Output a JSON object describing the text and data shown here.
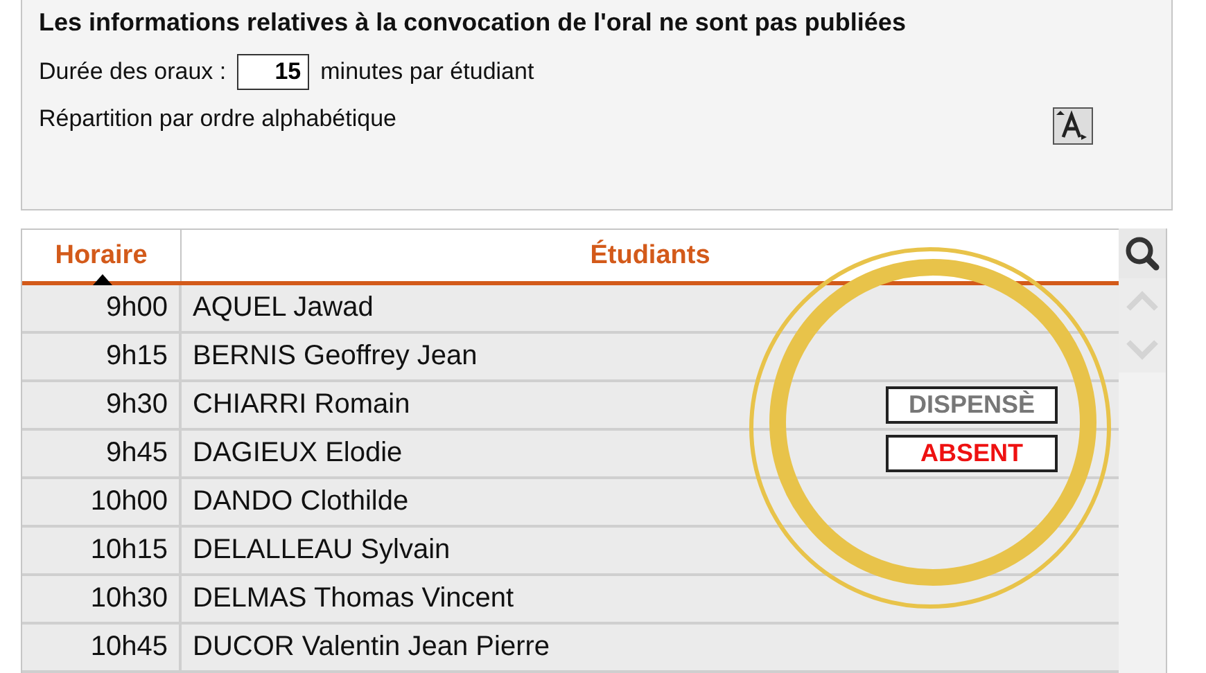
{
  "info_panel": {
    "title": "Les informations relatives à la convocation de l'oral ne sont pas publiées",
    "duration_label": "Durée des oraux :",
    "duration_value": "15",
    "duration_unit": "minutes par étudiant",
    "distribution": "Répartition par ordre alphabétique"
  },
  "table": {
    "columns": [
      {
        "label": "Horaire",
        "sorted": true
      },
      {
        "label": "Étudiants",
        "sorted": false
      }
    ],
    "rows": [
      {
        "time": "9h00",
        "student": "AQUEL Jawad"
      },
      {
        "time": "9h15",
        "student": "BERNIS Geoffrey Jean"
      },
      {
        "time": "9h30",
        "student": "CHIARRI Romain",
        "badge": {
          "kind": "dispensed",
          "label": "DISPENSÈ"
        }
      },
      {
        "time": "9h45",
        "student": "DAGIEUX Elodie",
        "badge": {
          "kind": "absent",
          "label": "ABSENT"
        }
      },
      {
        "time": "10h00",
        "student": "DANDO Clothilde"
      },
      {
        "time": "10h15",
        "student": "DELALLEAU Sylvain"
      },
      {
        "time": "10h30",
        "student": "DELMAS Thomas Vincent"
      },
      {
        "time": "10h45",
        "student": "DUCOR Valentin Jean Pierre"
      }
    ]
  }
}
